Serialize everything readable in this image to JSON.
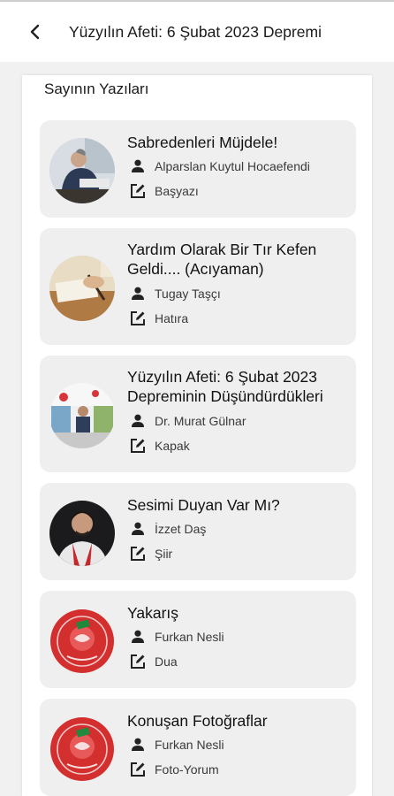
{
  "header": {
    "title": "Yüzyılın Afeti: 6 Şubat 2023 Depremi",
    "back_icon": "chevron-left-icon"
  },
  "section": {
    "title": "Sayının Yazıları"
  },
  "articles": [
    {
      "title": "Sabredenleri Müjdele!",
      "author": "Alparslan Kuytul Hocaefendi",
      "category": "Başyazı",
      "thumb": "portrait-desk"
    },
    {
      "title": "Yardım Olarak Bir Tır Kefen Geldi.... (Acıyaman)",
      "author": "Tugay Taşçı",
      "category": "Hatıra",
      "thumb": "writing-desk"
    },
    {
      "title": "Yüzyılın Afeti:  6 Şubat 2023 Depreminin Düşündürdükleri",
      "author": "Dr. Murat Gülnar",
      "category": "Kapak",
      "thumb": "event-stage"
    },
    {
      "title": "Sesimi Duyan Var Mı?",
      "author": "İzzet Daş",
      "category": "Şiir",
      "thumb": "portrait-scarf"
    },
    {
      "title": "Yakarış",
      "author": "Furkan Nesli",
      "category": "Dua",
      "thumb": "furkan-logo"
    },
    {
      "title": "Konuşan Fotoğraflar",
      "author": "Furkan Nesli",
      "category": "Foto-Yorum",
      "thumb": "furkan-logo"
    }
  ]
}
